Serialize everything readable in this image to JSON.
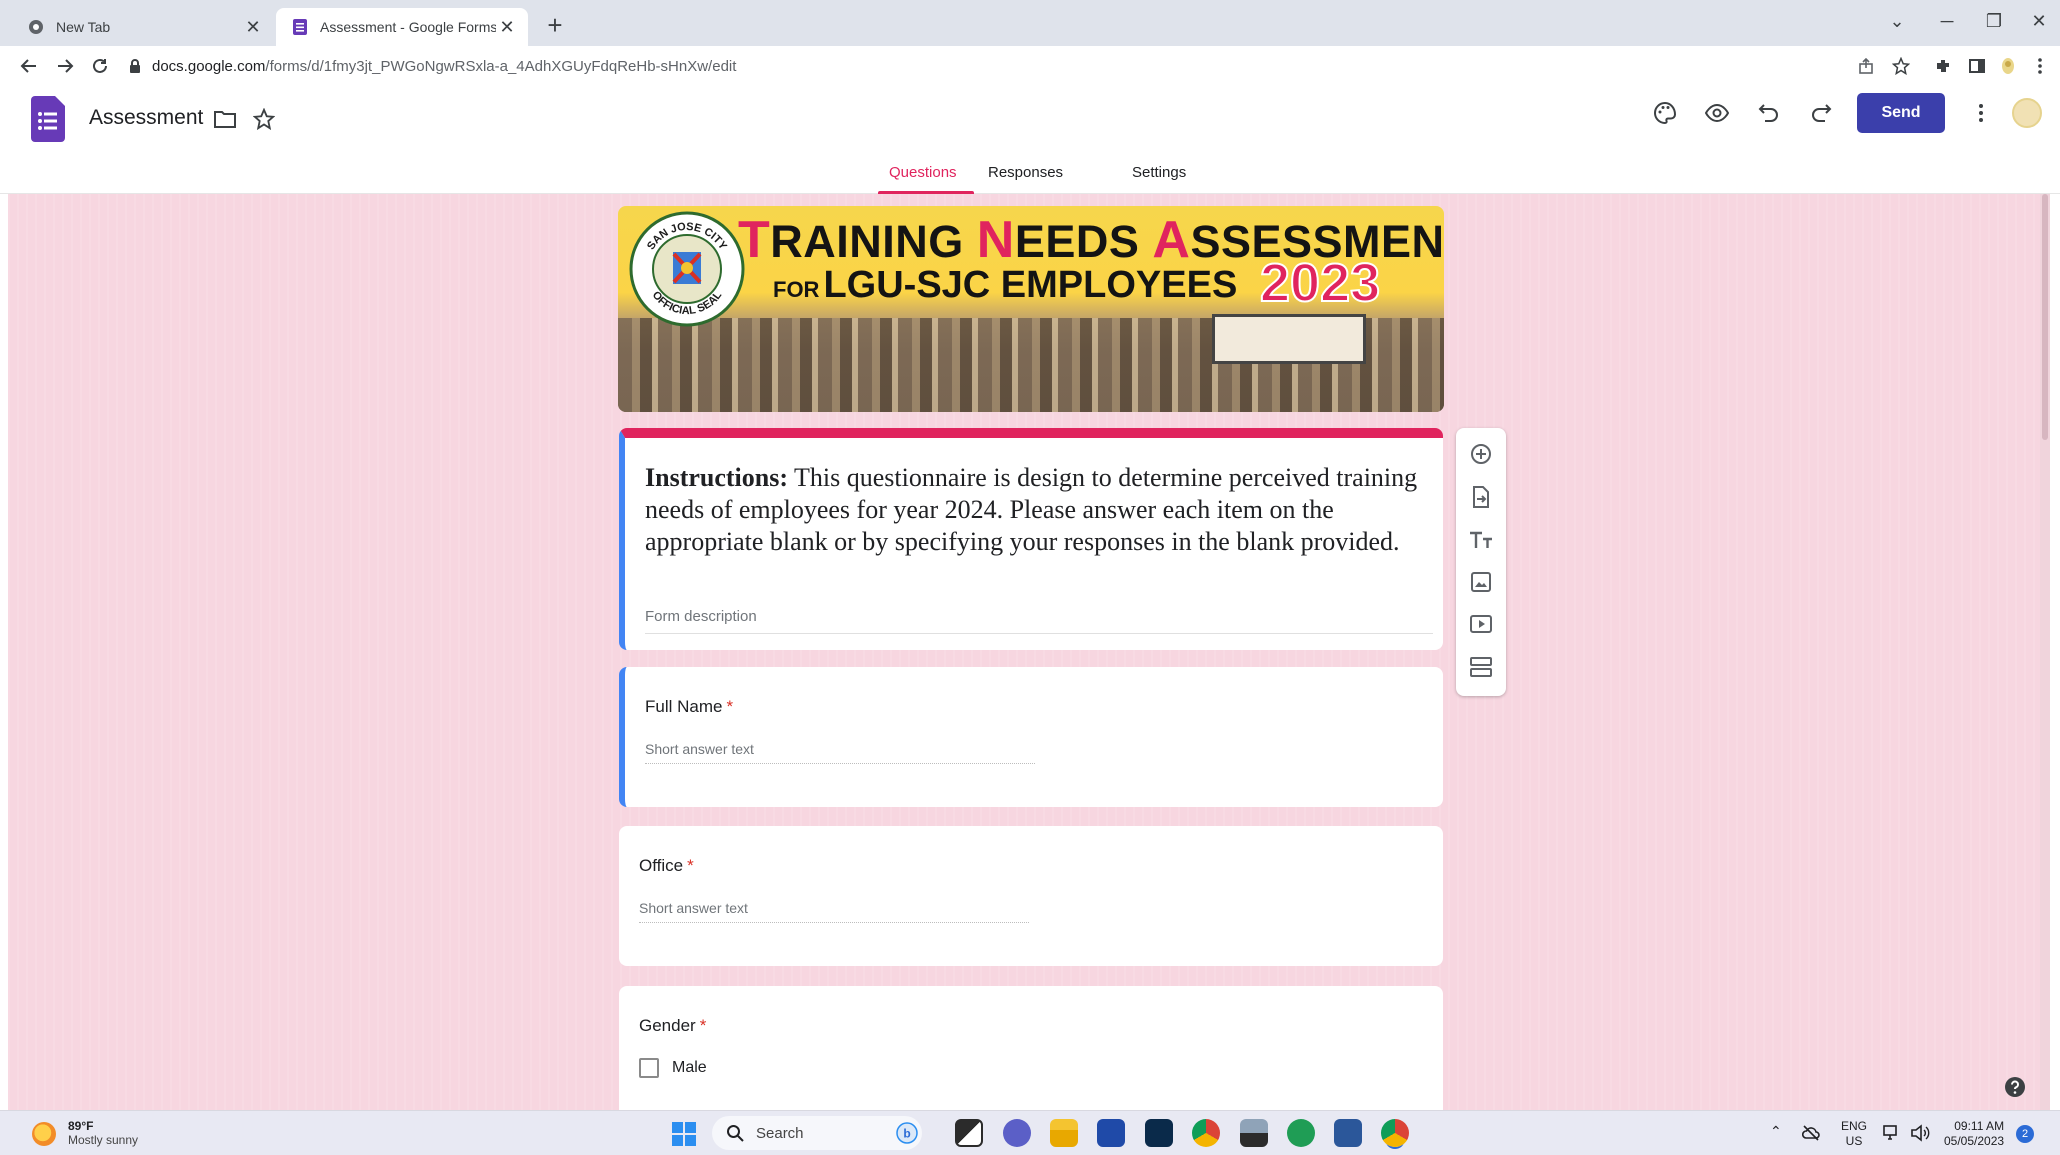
{
  "browser": {
    "tabs": [
      {
        "label": "New Tab",
        "active": false
      },
      {
        "label": "Assessment - Google Forms",
        "active": true
      }
    ],
    "url_host": "docs.google.com",
    "url_path": "/forms/d/1fmy3jt_PWGoNgwRSxla-a_4AdhXGUyFdqReHb-sHnXw/edit"
  },
  "app": {
    "doc_title": "Assessment",
    "send_label": "Send",
    "tabs": [
      {
        "label": "Questions",
        "active": true
      },
      {
        "label": "Responses",
        "active": false
      },
      {
        "label": "Settings",
        "active": false
      }
    ],
    "accent_color": "#e0245e",
    "send_color": "#3b3fab"
  },
  "banner": {
    "title_line1_parts": [
      "T",
      "RAINING ",
      "N",
      "EEDS ",
      "A",
      "SSESSMENT"
    ],
    "title_for": "FOR",
    "title_line2": "LGU-SJC EMPLOYEES",
    "year": "2023",
    "seal_top": "SAN JOSE CITY",
    "seal_bottom": "OFFICIAL SEAL"
  },
  "form": {
    "instructions_lead": "Instructions:",
    "instructions_body": " This questionnaire is design to determine perceived training needs of employees for year 2024.  Please answer each item on the appropriate blank or by specifying your responses in the blank provided.",
    "description_placeholder": "Form description",
    "questions": [
      {
        "title": "Full Name",
        "required_mark": "*",
        "answer_placeholder": "Short answer text"
      },
      {
        "title": "Office",
        "required_mark": "*",
        "answer_placeholder": "Short answer text"
      },
      {
        "title": "Gender",
        "required_mark": "*",
        "options": [
          "Male"
        ]
      }
    ]
  },
  "taskbar": {
    "weather_temp": "89°F",
    "weather_condition": "Mostly sunny",
    "search_label": "Search",
    "lang_line1": "ENG",
    "lang_line2": "US",
    "time": "09:11 AM",
    "date": "05/05/2023",
    "notification_count": "2"
  }
}
